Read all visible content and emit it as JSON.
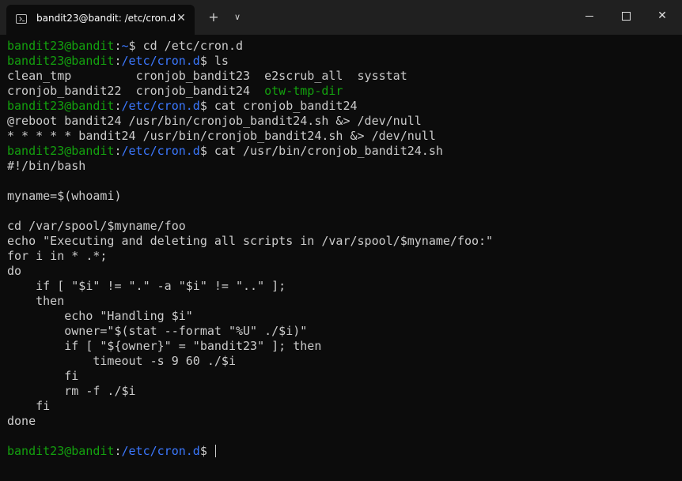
{
  "window": {
    "tab_title": "bandit23@bandit: /etc/cron.d",
    "tab_icon": "terminal-icon",
    "new_tab_glyph": "+",
    "dropdown_glyph": "∨",
    "close_tab_glyph": "✕",
    "close_glyph": "✕"
  },
  "colors": {
    "background": "#0c0c0c",
    "titlebar": "#202020",
    "prompt_user": "#13a10e",
    "prompt_path": "#3b78ff",
    "text": "#cccccc"
  },
  "terminal": {
    "prompt_user": "bandit23@bandit",
    "lines": [
      {
        "path": "~",
        "cmd": "cd /etc/cron.d"
      },
      {
        "path": "/etc/cron.d",
        "cmd": "ls"
      },
      {
        "ls_row": [
          "clean_tmp         ",
          "cronjob_bandit23  ",
          "e2scrub_all  ",
          "sysstat"
        ]
      },
      {
        "ls_row": [
          "cronjob_bandit22  ",
          "cronjob_bandit24  ",
          "otw-tmp-dir"
        ]
      },
      {
        "path": "/etc/cron.d",
        "cmd": "cat cronjob_bandit24"
      },
      {
        "output": "@reboot bandit24 /usr/bin/cronjob_bandit24.sh &> /dev/null"
      },
      {
        "output": "* * * * * bandit24 /usr/bin/cronjob_bandit24.sh &> /dev/null"
      },
      {
        "path": "/etc/cron.d",
        "cmd": "cat /usr/bin/cronjob_bandit24.sh"
      },
      {
        "output": "#!/bin/bash"
      },
      {
        "output": ""
      },
      {
        "output": "myname=$(whoami)"
      },
      {
        "output": ""
      },
      {
        "output": "cd /var/spool/$myname/foo"
      },
      {
        "output": "echo \"Executing and deleting all scripts in /var/spool/$myname/foo:\""
      },
      {
        "output": "for i in * .*;"
      },
      {
        "output": "do"
      },
      {
        "output": "    if [ \"$i\" != \".\" -a \"$i\" != \"..\" ];"
      },
      {
        "output": "    then"
      },
      {
        "output": "        echo \"Handling $i\""
      },
      {
        "output": "        owner=\"$(stat --format \"%U\" ./$i)\""
      },
      {
        "output": "        if [ \"${owner}\" = \"bandit23\" ]; then"
      },
      {
        "output": "            timeout -s 9 60 ./$i"
      },
      {
        "output": "        fi"
      },
      {
        "output": "        rm -f ./$i"
      },
      {
        "output": "    fi"
      },
      {
        "output": "done"
      },
      {
        "output": ""
      }
    ],
    "current_prompt": {
      "path": "/etc/cron.d"
    }
  }
}
